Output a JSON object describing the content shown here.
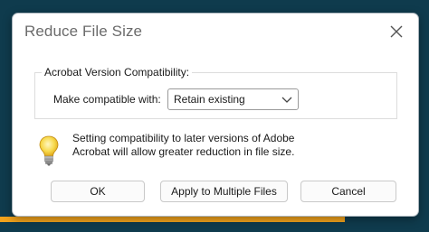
{
  "dialog": {
    "title": "Reduce File Size",
    "close_icon": "close-icon"
  },
  "compatibility": {
    "group_label": "Acrobat Version Compatibility:",
    "field_label": "Make compatible with:",
    "selected_value": "Retain existing"
  },
  "info": {
    "icon": "lightbulb-icon",
    "text": "Setting compatibility to later versions of Adobe Acrobat will allow greater reduction in file size."
  },
  "buttons": {
    "ok_label": "OK",
    "apply_label": "Apply to Multiple Files",
    "cancel_label": "Cancel"
  },
  "colors": {
    "background": "#0f3b4d",
    "accent_stripe": "#f2a31c",
    "dialog_background": "#ffffff"
  }
}
